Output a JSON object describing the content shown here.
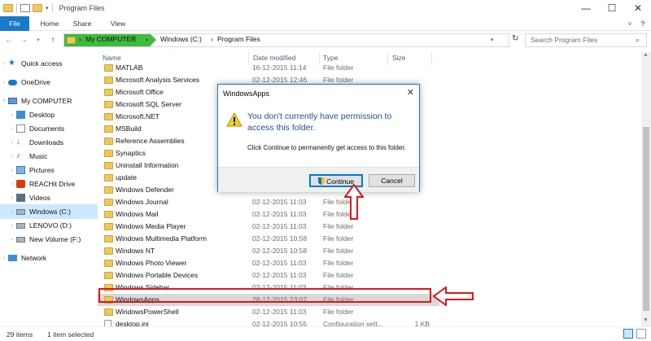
{
  "window": {
    "title": "Program Files",
    "controls": {
      "minimize": "—",
      "maximize": "☐",
      "close": "✕"
    }
  },
  "ribbon": {
    "tabs": [
      "File",
      "Home",
      "Share",
      "View"
    ],
    "expand_icon": "˅",
    "help_icon": "?"
  },
  "address": {
    "crumbs": [
      "My COMPUTER",
      "Windows (C:)",
      "Program Files"
    ],
    "search_placeholder": "Search Program Files"
  },
  "nav": {
    "items": [
      {
        "label": "Quick access",
        "icon": "star-icon"
      },
      {
        "label": "OneDrive",
        "icon": "cloud-icon"
      },
      {
        "label": "My COMPUTER",
        "icon": "computer-icon"
      },
      {
        "label": "Desktop",
        "icon": "desktop-icon"
      },
      {
        "label": "Documents",
        "icon": "documents-icon"
      },
      {
        "label": "Downloads",
        "icon": "downloads-icon"
      },
      {
        "label": "Music",
        "icon": "music-icon"
      },
      {
        "label": "Pictures",
        "icon": "pictures-icon"
      },
      {
        "label": "REACHit Drive",
        "icon": "drive-icon"
      },
      {
        "label": "Videos",
        "icon": "videos-icon"
      },
      {
        "label": "Windows (C:)",
        "icon": "disk-icon"
      },
      {
        "label": "LENOVO (D:)",
        "icon": "disk-icon"
      },
      {
        "label": "New Volume (F:)",
        "icon": "disk-icon"
      },
      {
        "label": "Network",
        "icon": "network-icon"
      }
    ]
  },
  "columns": {
    "name": "Name",
    "date": "Date modified",
    "type": "Type",
    "size": "Size"
  },
  "files": [
    {
      "name": "MATLAB",
      "date": "16-12-2015 11:14",
      "type": "File folder",
      "size": ""
    },
    {
      "name": "Microsoft Analysis Services",
      "date": "02-12-2015 12:46",
      "type": "File folder",
      "size": ""
    },
    {
      "name": "Microsoft Office",
      "date": "",
      "type": "",
      "size": ""
    },
    {
      "name": "Microsoft SQL Server",
      "date": "",
      "type": "",
      "size": ""
    },
    {
      "name": "Microsoft.NET",
      "date": "",
      "type": "",
      "size": ""
    },
    {
      "name": "MSBuild",
      "date": "",
      "type": "",
      "size": ""
    },
    {
      "name": "Reference Assemblies",
      "date": "",
      "type": "",
      "size": ""
    },
    {
      "name": "Synaptics",
      "date": "",
      "type": "",
      "size": ""
    },
    {
      "name": "Uninstall Information",
      "date": "",
      "type": "",
      "size": ""
    },
    {
      "name": "update",
      "date": "",
      "type": "",
      "size": ""
    },
    {
      "name": "Windows Defender",
      "date": "",
      "type": "",
      "size": ""
    },
    {
      "name": "Windows Journal",
      "date": "02-12-2015 11:03",
      "type": "File folder",
      "size": ""
    },
    {
      "name": "Windows Mail",
      "date": "02-12-2015 11:03",
      "type": "File folder",
      "size": ""
    },
    {
      "name": "Windows Media Player",
      "date": "02-12-2015 11:03",
      "type": "File folder",
      "size": ""
    },
    {
      "name": "Windows Multimedia Platform",
      "date": "02-12-2015 10:58",
      "type": "File folder",
      "size": ""
    },
    {
      "name": "Windows NT",
      "date": "02-12-2015 10:58",
      "type": "File folder",
      "size": ""
    },
    {
      "name": "Windows Photo Viewer",
      "date": "02-12-2015 11:03",
      "type": "File folder",
      "size": ""
    },
    {
      "name": "Windows Portable Devices",
      "date": "02-12-2015 11:03",
      "type": "File folder",
      "size": ""
    },
    {
      "name": "Windows Sidebar",
      "date": "02-12-2015 11:03",
      "type": "File folder",
      "size": ""
    },
    {
      "name": "WindowsApps",
      "date": "28-12-2015 23:07",
      "type": "File folder",
      "size": ""
    },
    {
      "name": "WindowsPowerShell",
      "date": "02-12-2015 11:03",
      "type": "File folder",
      "size": ""
    },
    {
      "name": "desktop.ini",
      "date": "02-12-2015 10:55",
      "type": "Configuration sett...",
      "size": "1 KB"
    }
  ],
  "status": {
    "items": "29 items",
    "selected": "1 item selected"
  },
  "dialog": {
    "title": "WindowsApps",
    "heading": "You don't currently have permission to access this folder.",
    "body": "Click Continue to permanently get access to this folder.",
    "continue_label": "Continue",
    "cancel_label": "Cancel",
    "close_glyph": "✕"
  },
  "colors": {
    "accent": "#1979ca",
    "highlight": "#e2141b",
    "breadcrumb": "#3dbb3d"
  }
}
